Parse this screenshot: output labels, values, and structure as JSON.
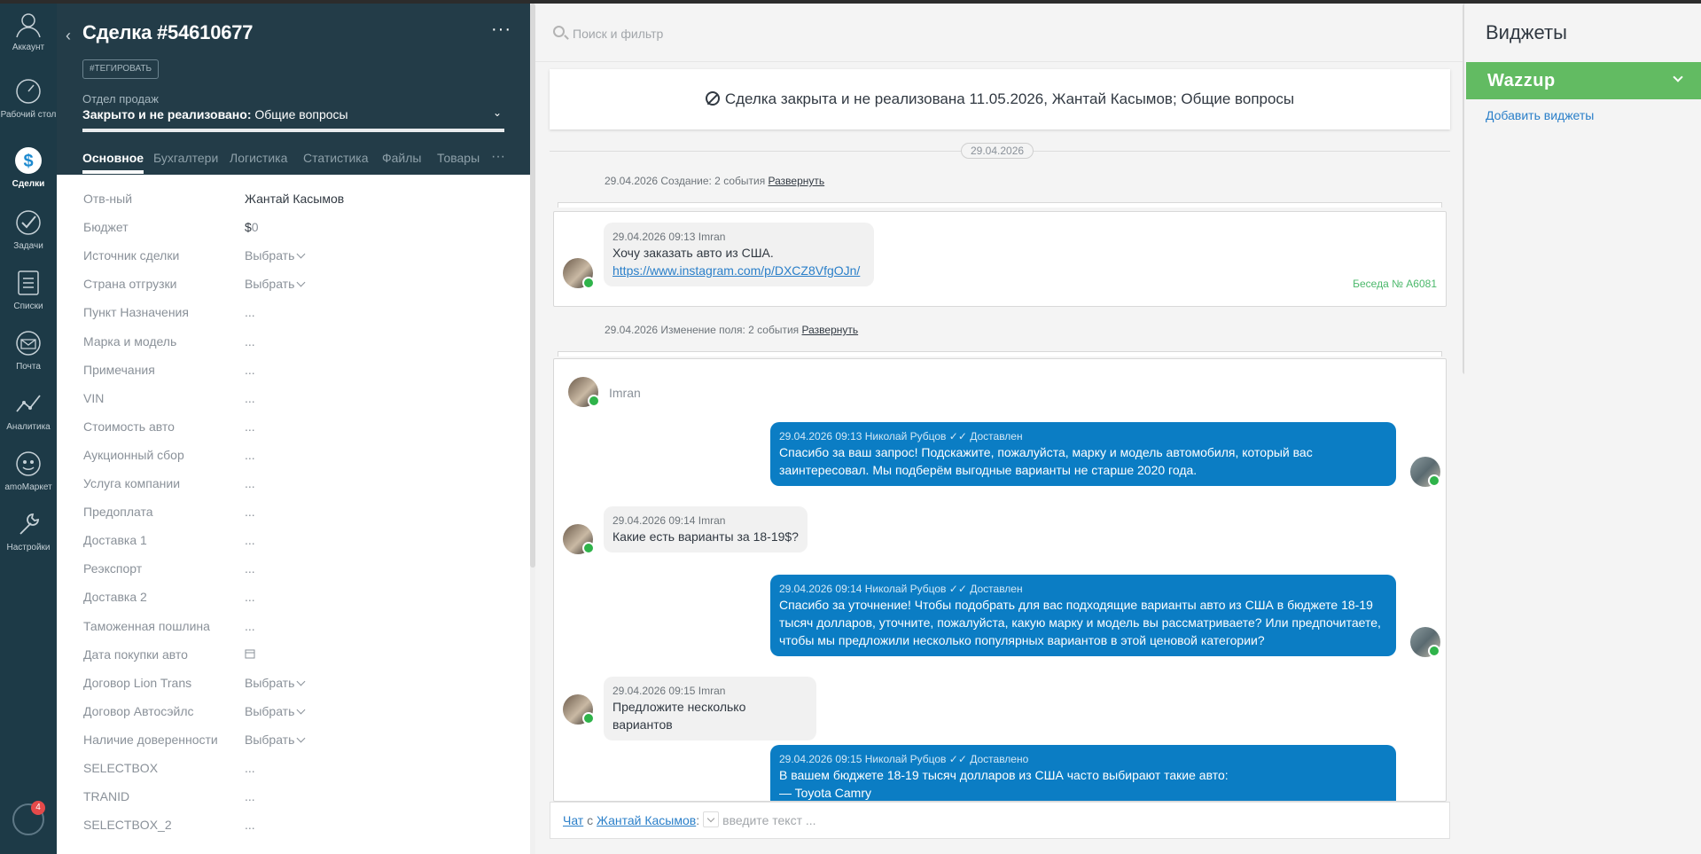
{
  "nav": {
    "items": [
      {
        "label": "Аккаунт",
        "icon": "user-icon"
      },
      {
        "label": "Рабочий стол",
        "icon": "dashboard-icon"
      },
      {
        "label": "Сделки",
        "icon": "deals-icon",
        "active": true
      },
      {
        "label": "Задачи",
        "icon": "tasks-icon"
      },
      {
        "label": "Списки",
        "icon": "lists-icon"
      },
      {
        "label": "Почта",
        "icon": "mail-icon"
      },
      {
        "label": "Аналитика",
        "icon": "analytics-icon"
      },
      {
        "label": "amoМаркет",
        "icon": "market-icon"
      },
      {
        "label": "Настройки",
        "icon": "settings-icon"
      }
    ],
    "notifications_count": "4"
  },
  "deal": {
    "title": "Сделка #54610677",
    "tag_button": "#ТЕГИРОВАТЬ",
    "pipeline_label": "Отдел продаж",
    "status_bold": "Закрыто и не реализовано:",
    "status_rest": " Общие вопросы",
    "tabs": [
      "Основное",
      "Бухгалтери",
      "Логистика",
      "Статистика",
      "Файлы",
      "Товары"
    ],
    "fields": [
      {
        "label": "Отв-ный",
        "value": "Жантай Касымов"
      },
      {
        "label": "Бюджет",
        "value": "$",
        "value2": "0"
      },
      {
        "label": "Источник сделки",
        "value": "Выбрать",
        "select": true
      },
      {
        "label": "Страна отгрузки",
        "value": "Выбрать",
        "select": true
      },
      {
        "label": "Пункт Назначения",
        "value": "..."
      },
      {
        "label": "Марка и модель",
        "value": "..."
      },
      {
        "label": "Примечания",
        "value": "..."
      },
      {
        "label": "VIN",
        "value": "..."
      },
      {
        "label": "Стоимость авто",
        "value": "..."
      },
      {
        "label": "Аукционный сбор",
        "value": "..."
      },
      {
        "label": "Услуга компании",
        "value": "..."
      },
      {
        "label": "Предоплата",
        "value": "..."
      },
      {
        "label": "Доставка 1",
        "value": "..."
      },
      {
        "label": "Реэкспорт",
        "value": "..."
      },
      {
        "label": "Доставка 2",
        "value": "..."
      },
      {
        "label": "Таможенная пошлина",
        "value": "..."
      },
      {
        "label": "Дата покупки авто",
        "value": "",
        "calendar": true
      },
      {
        "label": "Договор Lion Trans",
        "value": "Выбрать",
        "select": true
      },
      {
        "label": "Договор Автосэйлс",
        "value": "Выбрать",
        "select": true
      },
      {
        "label": "Наличие доверенности",
        "value": "Выбрать",
        "select": true
      },
      {
        "label": "SELECTBOX",
        "value": "..."
      },
      {
        "label": "TRANID",
        "value": "..."
      },
      {
        "label": "SELECTBOX_2",
        "value": "..."
      }
    ]
  },
  "feed": {
    "search_placeholder": "Поиск и фильтр",
    "closed_banner": "Сделка закрыта и не реализована 11.05.2026, Жантай Касымов; Общие вопросы",
    "date_pill": "29.04.2026",
    "event1": {
      "text": "29.04.2026 Создание: 2 события ",
      "link": "Развернуть"
    },
    "event2": {
      "text": "29.04.2026 Изменение поля: 2 события ",
      "link": "Развернуть"
    },
    "msg1": {
      "meta": "29.04.2026 09:13 Imran",
      "text": "Хочу заказать авто из США.",
      "link": "https://www.instagram.com/p/DXCZ8VfgOJn/",
      "conv": "Беседа № A6081"
    },
    "sender": "Imran",
    "out1": {
      "meta": "29.04.2026 09:13 Николай Рубцов",
      "status": "✓✓ Доставлен",
      "text": "Спасибо за ваш запрос! Подскажите, пожалуйста, марку и модель автомобиля, который вас заинтересовал. Мы подберём выгодные варианты не старше 2020 года."
    },
    "in2": {
      "meta": "29.04.2026 09:14 Imran",
      "text": "Какие есть варианты за 18-19$?"
    },
    "out2": {
      "meta": "29.04.2026 09:14 Николай Рубцов",
      "status": "✓✓ Доставлен",
      "text": "Спасибо за уточнение! Чтобы подобрать для вас подходящие варианты авто из США в бюджете 18-19 тысяч долларов, уточните, пожалуйста, какую марку и модель вы рассматриваете? Или предпочитаете, чтобы мы предложили несколько популярных вариантов в этой ценовой категории?"
    },
    "in3": {
      "meta": "29.04.2026 09:15 Imran",
      "text": "Предложите несколько вариантов"
    },
    "out3": {
      "meta": "29.04.2026 09:15 Николай Рубцов",
      "status": "✓✓ Доставлено",
      "text1": "В вашем бюджете 18-19 тысяч долларов из США часто выбирают такие авто:",
      "text2": "— Toyota Camry"
    },
    "chat_bar": {
      "chat": "Чат",
      "with": " с ",
      "contact": "Жантай Касымов",
      "placeholder": "введите текст ..."
    }
  },
  "widgets": {
    "title": "Виджеты",
    "wazzup": "Wazzup",
    "add": "Добавить виджеты"
  }
}
